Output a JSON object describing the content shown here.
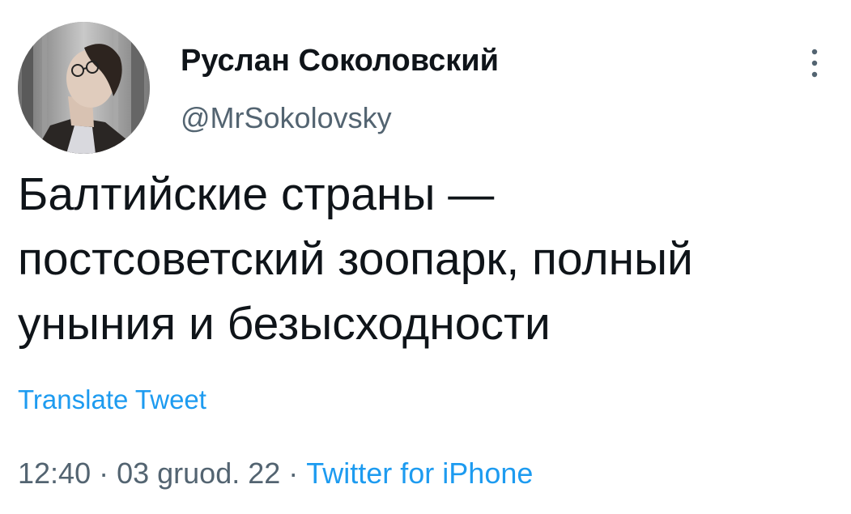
{
  "author": {
    "display_name": "Руслан Соколовский",
    "handle": "@MrSokolovsky"
  },
  "tweet": {
    "text_lines": [
      "Балтийские страны —",
      "постсоветский зоопарк, полный",
      "уныния и безысходности"
    ],
    "translate_label": "Translate Tweet"
  },
  "meta": {
    "time": "12:40",
    "separator": "·",
    "date": "03 gruod. 22",
    "source": "Twitter for iPhone"
  },
  "icons": {
    "more": "more-vertical-icon",
    "avatar": "avatar-photo"
  },
  "colors": {
    "text": "#0f1419",
    "secondary": "#536471",
    "accent": "#1d9bf0"
  }
}
